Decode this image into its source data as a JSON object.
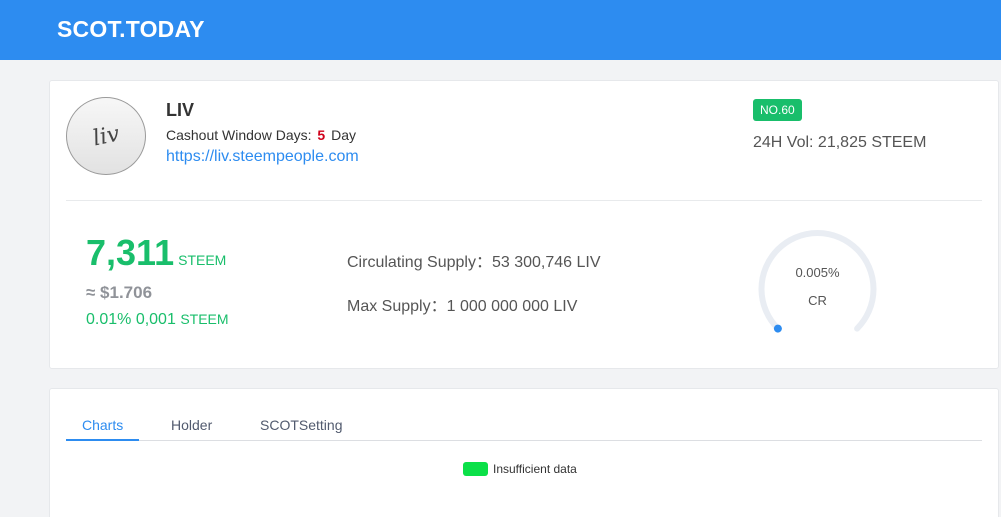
{
  "header": {
    "brand": "SCOT.TODAY"
  },
  "token": {
    "logo_text": "liv",
    "name": "LIV",
    "cashout_label": "Cashout Window Days:",
    "cashout_days": "5",
    "cashout_unit": "Day",
    "url": "https://liv.steempeople.com",
    "rank": "NO.60",
    "volume": "24H Vol: 21,825 STEEM"
  },
  "stats": {
    "price": "7,311",
    "price_unit": "STEEM",
    "usd_price": "≈ $1.706",
    "change": "0.01% 0,001",
    "change_unit": "STEEM",
    "circulating_supply": "Circulating Supply：53 300,746 LIV",
    "max_supply": "Max Supply：1 000 000 000 LIV"
  },
  "gauge": {
    "percent": "0.005%",
    "label": "CR",
    "value": 0.005,
    "track_color": "#e9edf3",
    "fill_color": "#2d8cf0"
  },
  "tabs": [
    {
      "label": "Charts",
      "active": true
    },
    {
      "label": "Holder",
      "active": false
    },
    {
      "label": "SCOTSetting",
      "active": false
    }
  ],
  "chart": {
    "legend_label": "Insufficient data",
    "legend_color": "#0be048"
  },
  "colors": {
    "header": "#2d8cf0",
    "green": "#19be6b",
    "accent": "#2d8cf0",
    "cashout_days": "#d0021b"
  }
}
